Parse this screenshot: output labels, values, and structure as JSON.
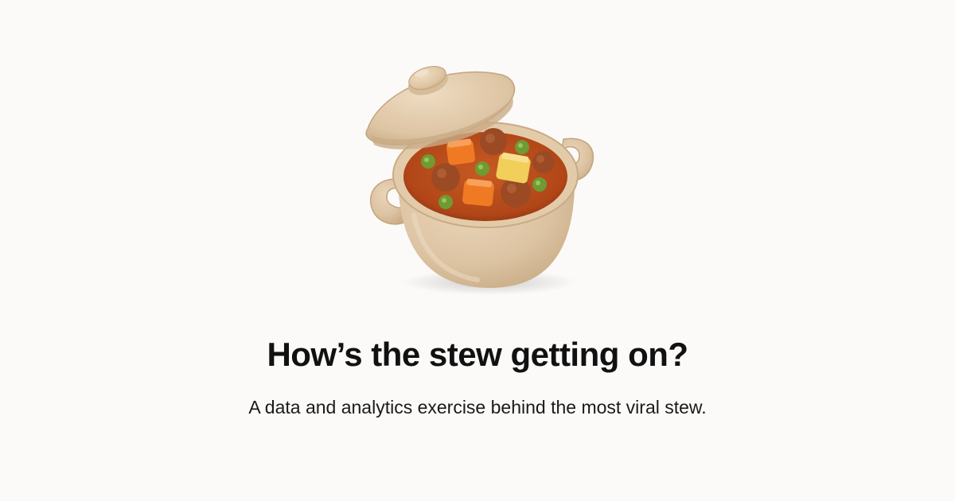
{
  "hero": {
    "illustration": "stew-pot-icon"
  },
  "headline": {
    "title": "How’s the stew getting on?",
    "subtitle": "A data and analytics exercise behind the most viral stew."
  },
  "colors": {
    "background": "#fbfaf8",
    "pot": "#dcc3a2",
    "pot_shadow": "#c9ab86",
    "stew": "#b54a1c",
    "carrot": "#f07a24",
    "potato": "#f1cf5a",
    "pea": "#6f9a34",
    "meatball": "#9b4a24",
    "text": "#111111"
  }
}
